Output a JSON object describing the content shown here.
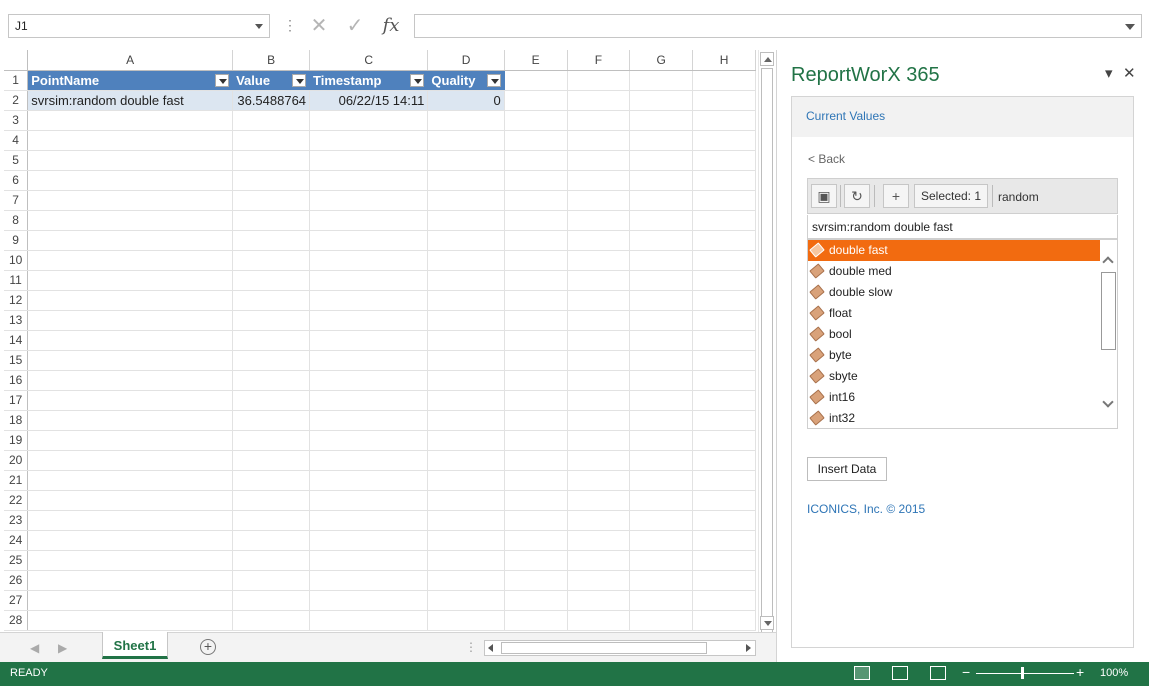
{
  "formula_bar": {
    "namebox": "J1",
    "cancel_icon": "✕",
    "enter_icon": "✓",
    "fx_label": "fx",
    "formula_value": ""
  },
  "sheet": {
    "columns": [
      "A",
      "B",
      "C",
      "D",
      "E",
      "F",
      "G",
      "H"
    ],
    "table_headers": [
      "PointName",
      "Value",
      "Timestamp",
      "Quality"
    ],
    "row2": {
      "pointname": "svrsim:random double fast",
      "value": "36.5488764",
      "timestamp": "06/22/15 14:11",
      "quality": "0"
    },
    "row_numbers": [
      "1",
      "2",
      "3",
      "4",
      "5",
      "6",
      "7",
      "8",
      "9",
      "10",
      "11",
      "12",
      "13",
      "14",
      "15",
      "16",
      "17",
      "18",
      "19",
      "20",
      "21",
      "22",
      "23",
      "24",
      "25",
      "26",
      "27",
      "28"
    ]
  },
  "tabbar": {
    "prev_icon": "◀",
    "next_icon": "▶",
    "sheet_tab": "Sheet1",
    "add_sheet_icon": "+",
    "separator": "⋮"
  },
  "pane": {
    "title": "ReportWorX 365",
    "menu_icon": "▾",
    "close_icon": "✕",
    "section": "Current Values",
    "back": "< Back",
    "toolbar": {
      "folder_icon": "▣",
      "refresh_icon": "↻",
      "add_icon": "+",
      "selected": "Selected: 1",
      "filter": "random"
    },
    "path": "svrsim:random double fast",
    "items": [
      {
        "label": "double fast"
      },
      {
        "label": "double med"
      },
      {
        "label": "double slow"
      },
      {
        "label": "float"
      },
      {
        "label": "bool"
      },
      {
        "label": "byte"
      },
      {
        "label": "sbyte"
      },
      {
        "label": "int16"
      },
      {
        "label": "int32"
      }
    ],
    "selected_index": 0,
    "insert_button": "Insert Data",
    "copyright": "ICONICS, Inc. © 2015"
  },
  "statusbar": {
    "status": "READY",
    "zoom_minus": "−",
    "zoom_plus": "+",
    "zoom": "100%"
  },
  "colors": {
    "excel_green": "#217346",
    "table_header_blue": "#4f81bd",
    "table_row_blue": "#dce6f1",
    "selection_orange": "#f26b10",
    "link_blue": "#2e75b6"
  }
}
